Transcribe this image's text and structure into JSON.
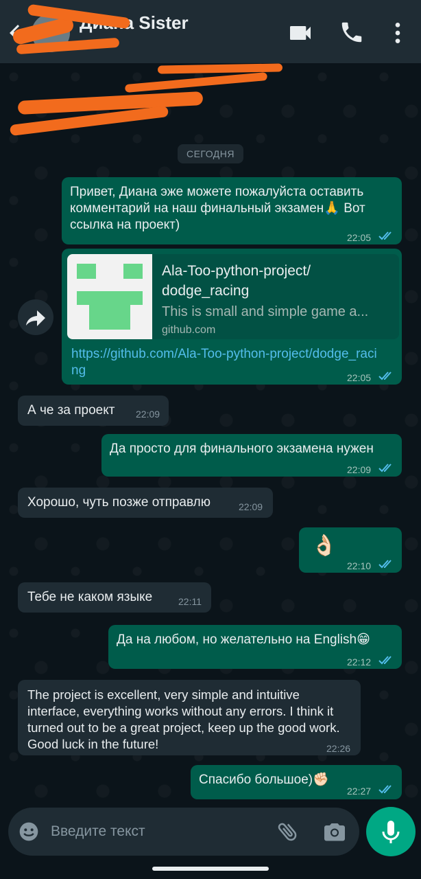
{
  "header": {
    "contact_name": "Диана Sister",
    "contact_status": "",
    "icons": [
      "back-arrow-icon",
      "video-call-icon",
      "phone-icon",
      "more-vert-icon"
    ]
  },
  "chat": {
    "date_chip": "СЕГОДНЯ",
    "messages": [
      {
        "dir": "out",
        "text": "Привет, Диана эже можете пожалуйста оставить комментарий на наш финальный экзамен🙏 Вот ссылка на проект)",
        "time": "22:05",
        "read": true
      },
      {
        "dir": "out",
        "link_title": "Ala-Too-python-project/ dodge_racing",
        "link_desc": "This is small and simple game a...",
        "link_domain": "github.com",
        "url": "https://github.com/Ala-Too-python-project/dodge_racing",
        "time": "22:05",
        "read": true
      },
      {
        "dir": "in",
        "text": "А че за проект",
        "time": "22:09"
      },
      {
        "dir": "out",
        "text": "Да просто для финального экзамена нужен",
        "time": "22:09",
        "read": true
      },
      {
        "dir": "in",
        "text": "Хорошо, чуть позже отправлю",
        "time": "22:09"
      },
      {
        "dir": "out",
        "text": "👌🏻",
        "time": "22:10",
        "read": true
      },
      {
        "dir": "in",
        "text": "Тебе не каком языке",
        "time": "22:11"
      },
      {
        "dir": "out",
        "text": "Да на любом, но желательно на English😁",
        "time": "22:12",
        "read": true
      },
      {
        "dir": "in",
        "text": "The project is excellent, very simple and intuitive interface, everything works without any errors. I think it turned out to be a great project, keep up the good work. Good luck in the future!",
        "time": "22:26"
      },
      {
        "dir": "out",
        "text": "Спасибо большое)✊🏻",
        "time": "22:27",
        "read": true
      }
    ]
  },
  "composer": {
    "placeholder": "Введите текст",
    "icons": [
      "emoji-icon",
      "attach-icon",
      "camera-icon",
      "mic-icon"
    ]
  },
  "colors": {
    "header_bg": "#1f2c34",
    "chat_bg": "#0b141a",
    "outgoing_bubble": "#005c4b",
    "incoming_bubble": "#1f2c34",
    "accent": "#00a884",
    "link": "#53bdeb",
    "read_ticks": "#53bdeb"
  }
}
